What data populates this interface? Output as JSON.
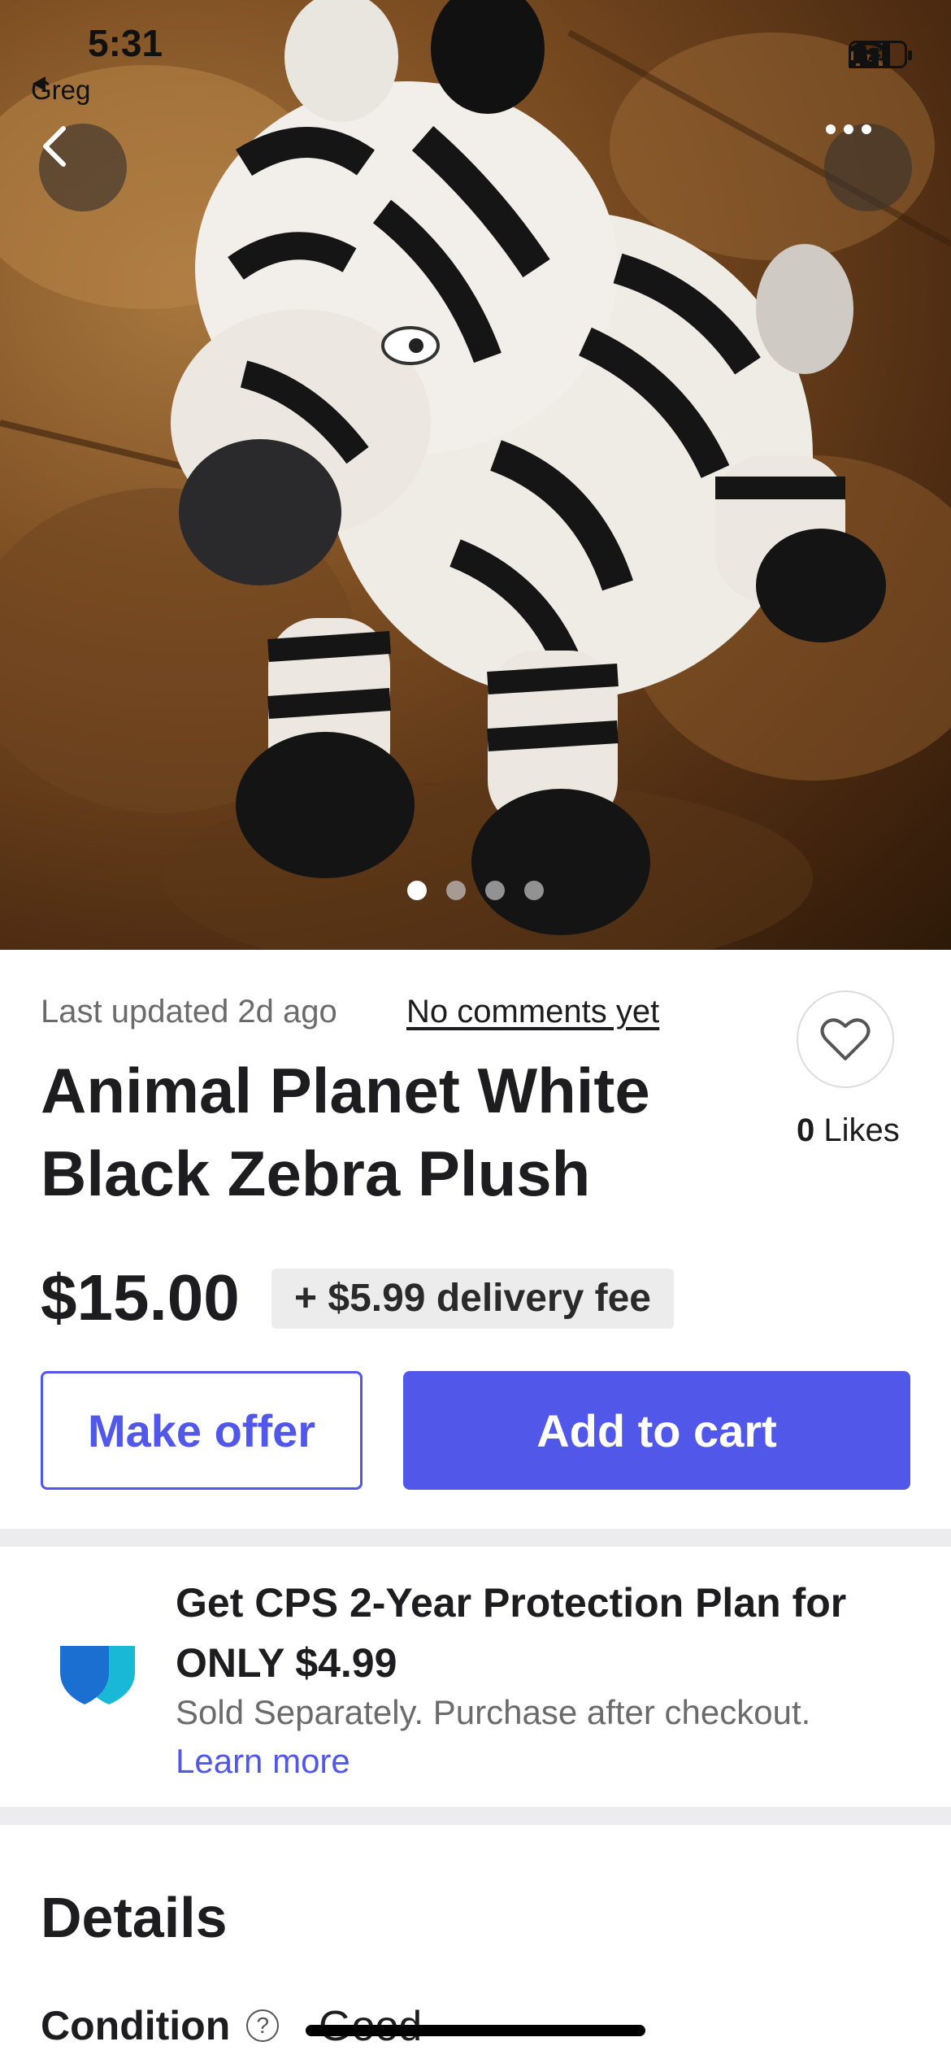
{
  "status_bar": {
    "time": "5:31",
    "back_app": "Greg",
    "back_arrow_icon": "small-left-triangle-icon",
    "battery": "21"
  },
  "hero": {
    "image": "zebra-plush-photo",
    "back_icon": "chevron-left-icon",
    "more_icon": "ellipsis-icon",
    "page_count": 4,
    "active_index": 0
  },
  "listing": {
    "updated": "Last updated 2d ago",
    "comments_link": "No comments yet",
    "title_line1": "Animal Planet White",
    "title_line2": "Black Zebra Plush",
    "likes_count": "0",
    "likes_label": "Likes",
    "price": "$15.00",
    "delivery_fee": "+ $5.99 delivery fee"
  },
  "actions": {
    "make_offer": "Make offer",
    "add_to_cart": "Add to cart"
  },
  "protection": {
    "title_line1": "Get CPS 2-Year Protection Plan for",
    "title_line2": "ONLY $4.99",
    "subtitle": "Sold Separately. Purchase after checkout.",
    "learn_more": "Learn more"
  },
  "details": {
    "heading": "Details",
    "condition_label": "Condition",
    "condition_value": "Good"
  },
  "colors": {
    "accent": "#5157e8",
    "muted_text": "#6b6b6b",
    "shield_dark": "#1a6fd1",
    "shield_light": "#18b8d6"
  }
}
